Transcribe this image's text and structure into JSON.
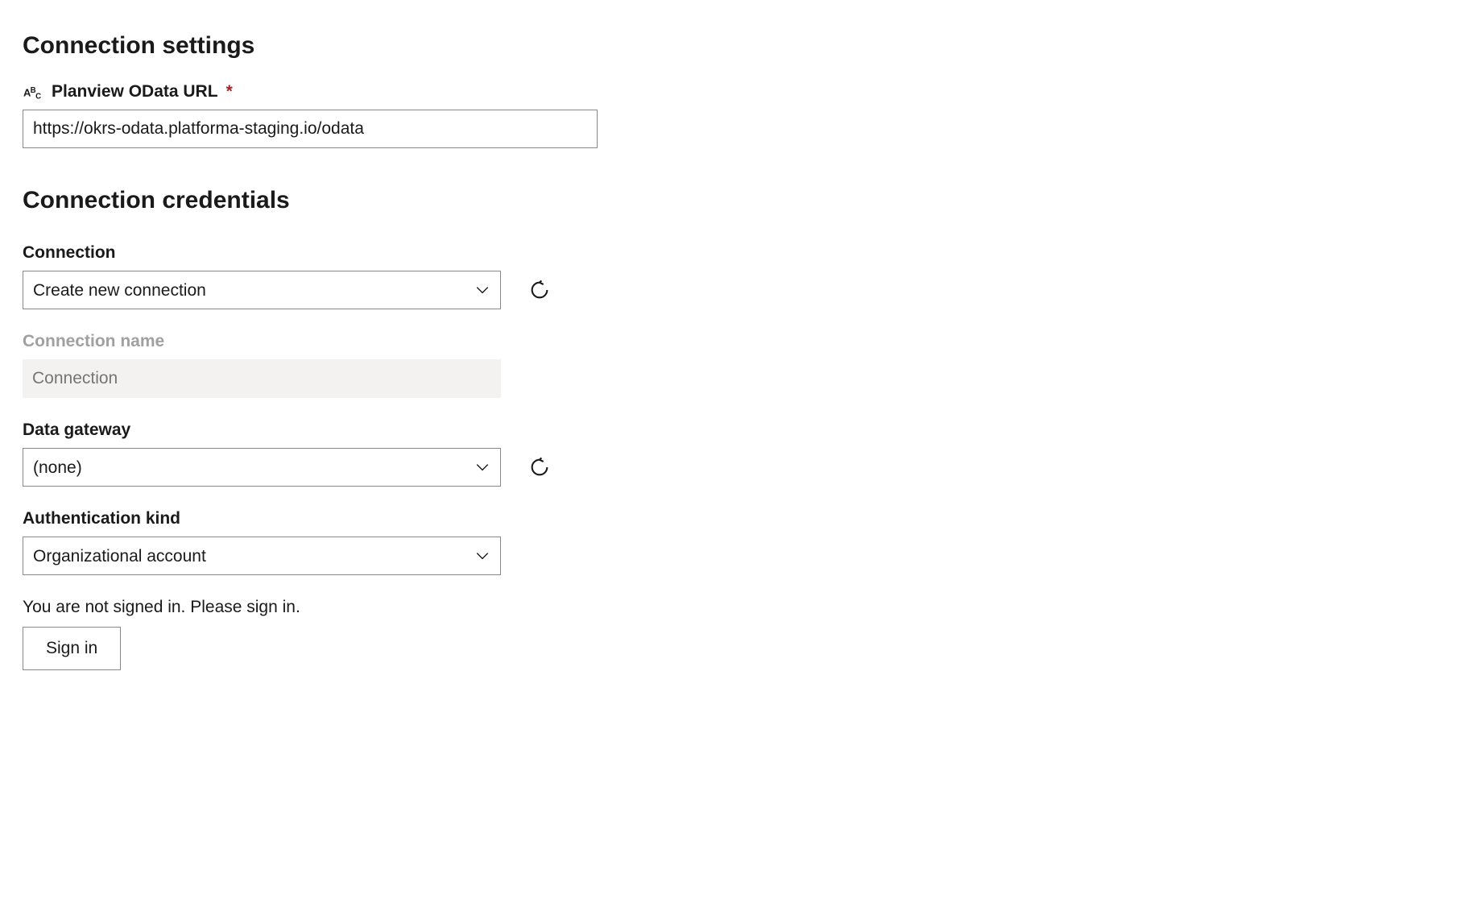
{
  "settings": {
    "heading": "Connection settings",
    "url_label": "Planview OData URL",
    "url_value": "https://okrs-odata.platforma-staging.io/odata"
  },
  "credentials": {
    "heading": "Connection credentials",
    "connection_label": "Connection",
    "connection_value": "Create new connection",
    "connection_name_label": "Connection name",
    "connection_name_placeholder": "Connection",
    "gateway_label": "Data gateway",
    "gateway_value": "(none)",
    "auth_label": "Authentication kind",
    "auth_value": "Organizational account",
    "signin_msg": "You are not signed in. Please sign in.",
    "signin_btn": "Sign in"
  }
}
